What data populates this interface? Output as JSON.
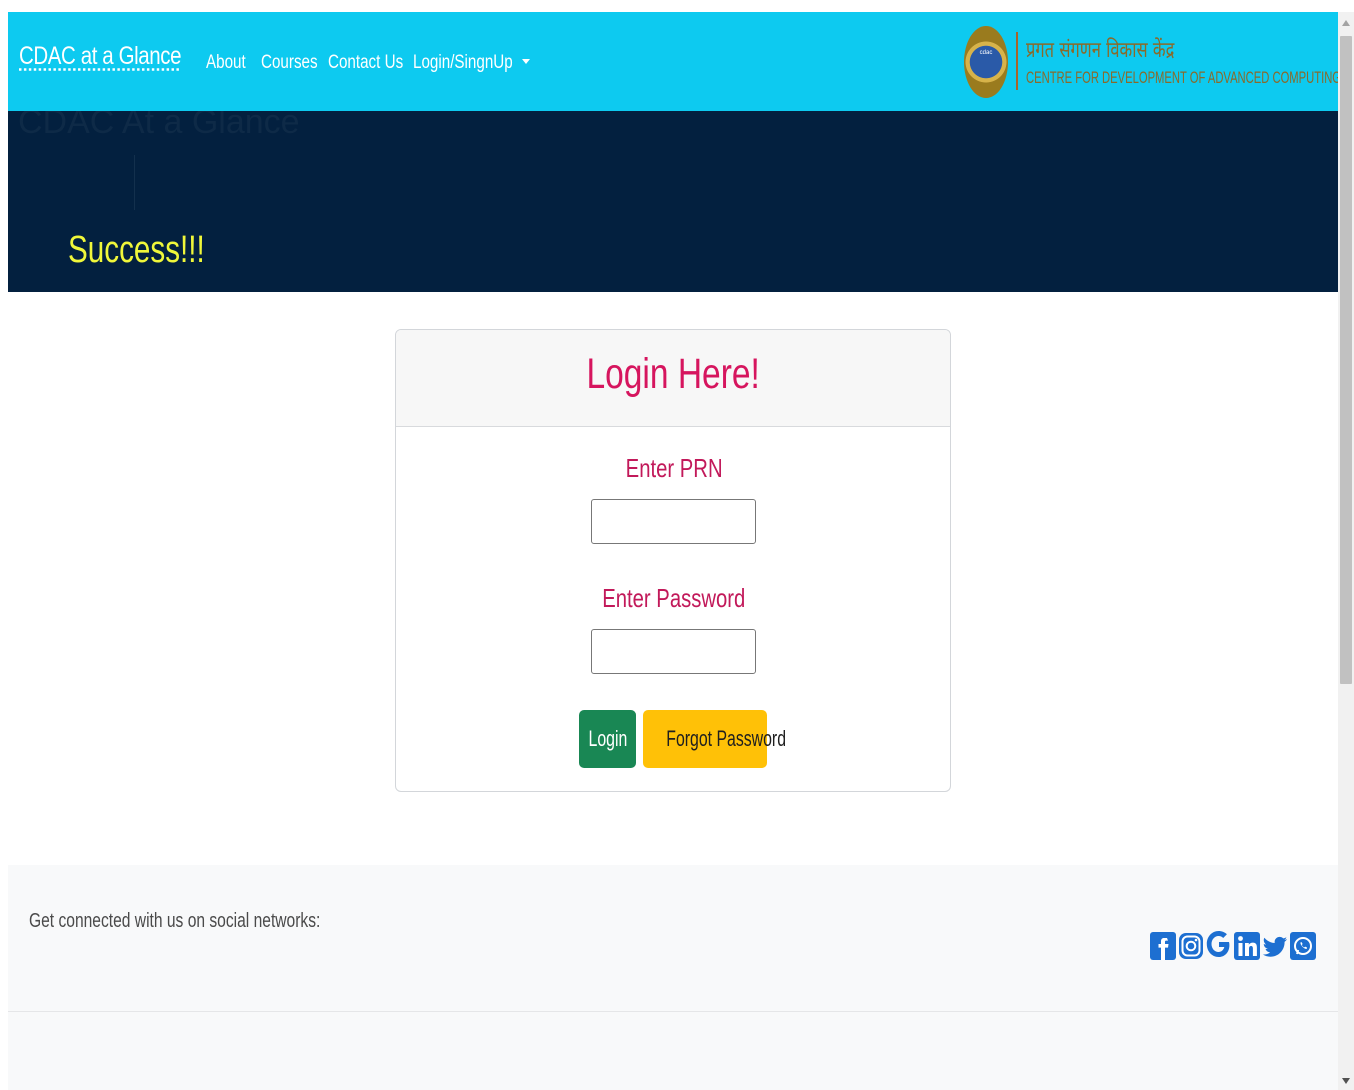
{
  "navbar": {
    "brand": "CDAC at a Glance",
    "links": {
      "about": "About",
      "courses": "Courses",
      "contact": "Contact Us",
      "login": "Login/SingnUp"
    },
    "logo": {
      "hindi": "प्रगत संगणन विकास केंद्र",
      "english": "CENTRE FOR DEVELOPMENT OF ADVANCED COMPUTING",
      "seal_text": "cdac"
    },
    "color": "#0dcaf0"
  },
  "hero": {
    "ghost_title": "CDAC At a Glance",
    "message": "Success!!!",
    "background": "#03203f",
    "message_color": "#f0f73a"
  },
  "login_card": {
    "title": "Login Here!",
    "prn_label": "Enter PRN",
    "prn_value": "",
    "password_label": "Enter Password",
    "password_value": "",
    "login_button": "Login",
    "forgot_button": "Forgot Password",
    "accent_color": "#d6155e"
  },
  "footer": {
    "connect_text": "Get connected with us on social networks:",
    "social_icons": [
      "facebook-icon",
      "instagram-icon",
      "google-icon",
      "linkedin-icon",
      "twitter-icon",
      "whatsapp-icon"
    ],
    "icon_color": "#1d6fd1"
  }
}
